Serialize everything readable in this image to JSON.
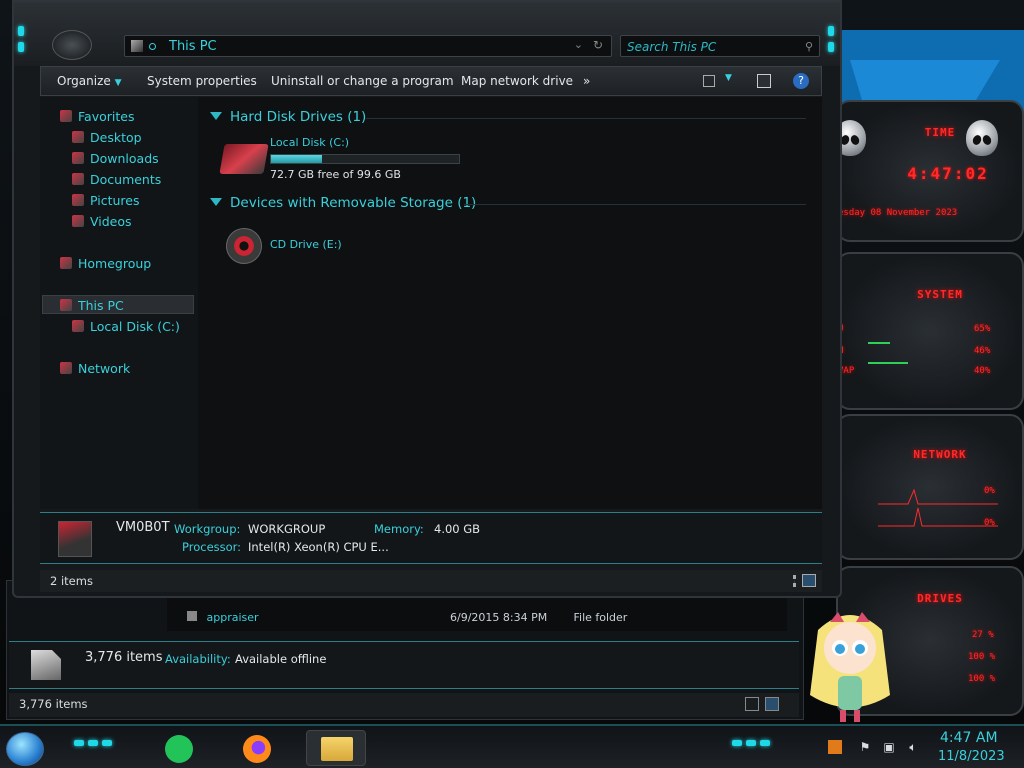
{
  "window": {
    "address": "This PC",
    "search_placeholder": "Search This PC"
  },
  "toolbar": {
    "organize": "Organize",
    "system_properties": "System properties",
    "uninstall": "Uninstall or change a program",
    "map_drive": "Map network drive",
    "more": "»"
  },
  "nav": {
    "favorites": "Favorites",
    "desktop": "Desktop",
    "downloads": "Downloads",
    "documents": "Documents",
    "pictures": "Pictures",
    "videos": "Videos",
    "homegroup": "Homegroup",
    "this_pc": "This PC",
    "local_disk": "Local Disk (C:)",
    "network": "Network"
  },
  "content": {
    "group_hdd": "Hard Disk Drives (1)",
    "group_removable": "Devices with Removable Storage (1)",
    "drive_c_name": "Local Disk (C:)",
    "drive_c_space": "72.7 GB free of 99.6 GB",
    "drive_c_used_fraction": 0.27,
    "drive_e_name": "CD Drive (E:)"
  },
  "details": {
    "computer_name": "VM0B0T",
    "workgroup_label": "Workgroup:",
    "workgroup_value": "WORKGROUP",
    "memory_label": "Memory:",
    "memory_value": "4.00 GB",
    "processor_label": "Processor:",
    "processor_value": "Intel(R) Xeon(R) CPU E..."
  },
  "status": {
    "items": "2 items"
  },
  "bg_window": {
    "row1_name": "appraiser",
    "row1_date": "6/9/2015 8:34 PM",
    "row1_type": "File folder",
    "items_count": "3,776 items",
    "availability_label": "Availability:",
    "availability_value": "Available offline",
    "status_items": "3,776 items"
  },
  "gadgets": {
    "time_title": "TIME",
    "time_value": "4:47:02",
    "date_value": "esday 08 November 2023",
    "system_title": "SYSTEM",
    "cpu_pct": "65%",
    "ram_pct": "46%",
    "swap_pct": "40%",
    "network_title": "NETWORK",
    "net_in": "0%",
    "net_out": "0%",
    "drives_title": "DRIVES",
    "drive1": "27 %",
    "drive2": "100 %",
    "drive3": "100 %"
  },
  "taskbar": {
    "time": "4:47 AM",
    "date": "11/8/2023"
  }
}
